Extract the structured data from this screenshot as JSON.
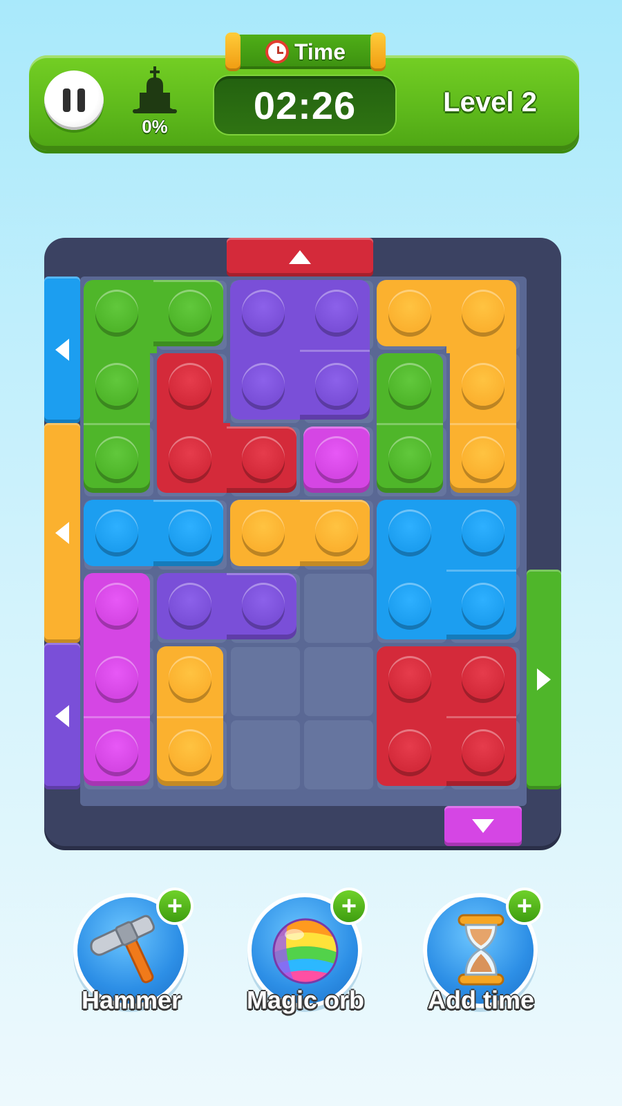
{
  "hud": {
    "time_label": "Time",
    "timer": "02:26",
    "progress": "0%",
    "level": "Level 2"
  },
  "colors": {
    "green": "#4fb62a",
    "purple": "#7a4fd8",
    "orange": "#fbb12f",
    "red": "#d42a3a",
    "magenta": "#d546e4",
    "blue": "#1c9ef0",
    "board_frame": "#3b4262",
    "empty_cell": "#66759f"
  },
  "board": {
    "cols": 6,
    "rows": 7,
    "pieces": [
      {
        "name": "green-l-piece",
        "color": "green",
        "cells": [
          [
            0,
            0
          ],
          [
            1,
            0
          ],
          [
            0,
            1
          ],
          [
            0,
            2
          ]
        ]
      },
      {
        "name": "purple-square-piece",
        "color": "purple",
        "cells": [
          [
            2,
            0
          ],
          [
            3,
            0
          ],
          [
            2,
            1
          ],
          [
            3,
            1
          ]
        ]
      },
      {
        "name": "orange-j-piece",
        "color": "orange",
        "cells": [
          [
            4,
            0
          ],
          [
            5,
            0
          ],
          [
            5,
            1
          ],
          [
            5,
            2
          ]
        ]
      },
      {
        "name": "red-l-piece",
        "color": "red",
        "cells": [
          [
            1,
            1
          ],
          [
            1,
            2
          ],
          [
            2,
            2
          ]
        ]
      },
      {
        "name": "green-vertical-piece",
        "color": "green",
        "cells": [
          [
            4,
            1
          ],
          [
            4,
            2
          ]
        ]
      },
      {
        "name": "magenta-single-piece",
        "color": "magenta",
        "cells": [
          [
            3,
            2
          ]
        ]
      },
      {
        "name": "blue-horizontal-piece",
        "color": "blue",
        "cells": [
          [
            0,
            3
          ],
          [
            1,
            3
          ]
        ]
      },
      {
        "name": "orange-horizontal-piece",
        "color": "orange",
        "cells": [
          [
            2,
            3
          ],
          [
            3,
            3
          ]
        ]
      },
      {
        "name": "blue-square-piece",
        "color": "blue",
        "cells": [
          [
            4,
            3
          ],
          [
            5,
            3
          ],
          [
            4,
            4
          ],
          [
            5,
            4
          ]
        ]
      },
      {
        "name": "magenta-vertical-piece",
        "color": "magenta",
        "cells": [
          [
            0,
            4
          ],
          [
            0,
            5
          ],
          [
            0,
            6
          ]
        ]
      },
      {
        "name": "purple-horizontal-piece",
        "color": "purple",
        "cells": [
          [
            1,
            4
          ],
          [
            2,
            4
          ]
        ]
      },
      {
        "name": "orange-vertical-piece",
        "color": "orange",
        "cells": [
          [
            1,
            5
          ],
          [
            1,
            6
          ]
        ]
      },
      {
        "name": "red-square-piece",
        "color": "red",
        "cells": [
          [
            4,
            5
          ],
          [
            5,
            5
          ],
          [
            4,
            6
          ],
          [
            5,
            6
          ]
        ]
      }
    ],
    "gates": [
      {
        "name": "red-exit-gate-top",
        "color": "red",
        "side": "top",
        "direction": "up",
        "from": 2,
        "span": 2
      },
      {
        "name": "blue-exit-gate-left",
        "color": "blue",
        "side": "left",
        "direction": "left",
        "from": 0,
        "span": 2
      },
      {
        "name": "orange-exit-gate-left",
        "color": "orange",
        "side": "left",
        "direction": "left",
        "from": 2,
        "span": 3
      },
      {
        "name": "purple-exit-gate-left",
        "color": "purple",
        "side": "left",
        "direction": "left",
        "from": 5,
        "span": 2
      },
      {
        "name": "green-exit-gate-right",
        "color": "green",
        "side": "right",
        "direction": "right",
        "from": 4,
        "span": 3
      },
      {
        "name": "magenta-exit-gate-bottom",
        "color": "magenta",
        "side": "bottom",
        "direction": "down",
        "from": 5,
        "span": 1
      }
    ]
  },
  "boosters": [
    {
      "label": "Hammer",
      "icon": "hammer-icon"
    },
    {
      "label": "Magic orb",
      "icon": "magic-orb-icon"
    },
    {
      "label": "Add time",
      "icon": "hourglass-icon"
    }
  ]
}
